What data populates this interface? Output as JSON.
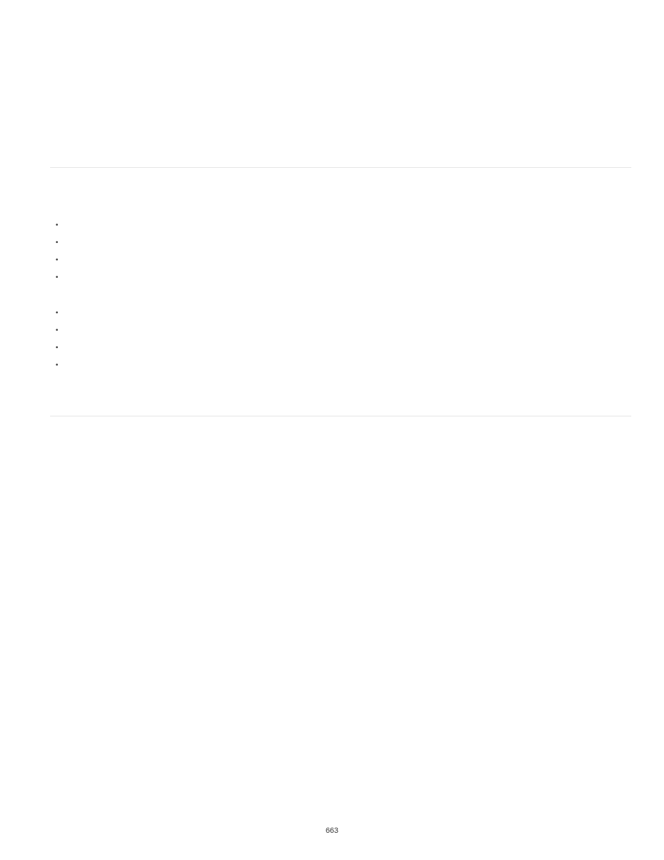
{
  "lists": {
    "group1": [
      "",
      "",
      "",
      ""
    ],
    "group2": [
      "",
      "",
      "",
      ""
    ]
  },
  "pageNumber": "663"
}
